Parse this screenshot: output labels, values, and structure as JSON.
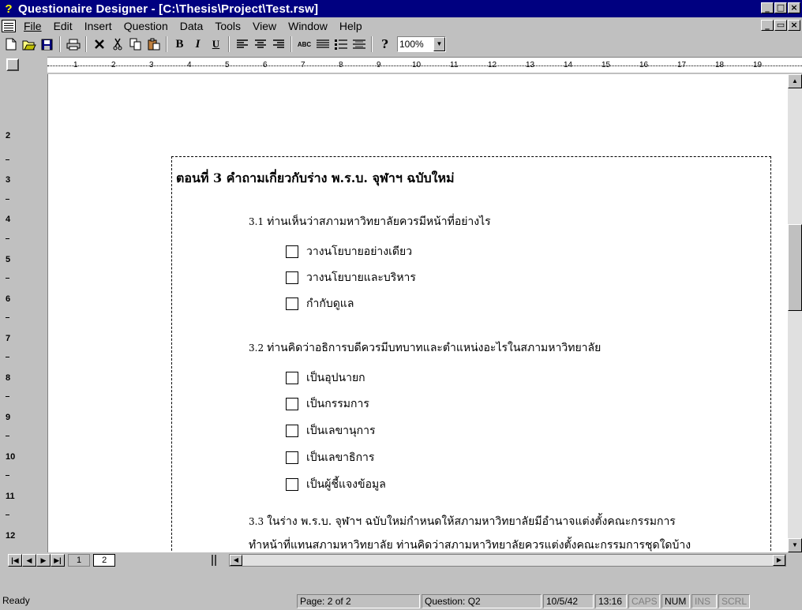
{
  "window": {
    "app_icon": "?",
    "title": "Questionaire Designer - [C:\\Thesis\\Project\\Test.rsw]",
    "buttons": [
      "_",
      "□",
      "×"
    ],
    "mdi_buttons": [
      "_",
      "▭",
      "×"
    ]
  },
  "menu": {
    "items": [
      "File",
      "Edit",
      "Insert",
      "Question",
      "Data",
      "Tools",
      "View",
      "Window",
      "Help"
    ]
  },
  "toolbar": {
    "bold": "B",
    "italic": "I",
    "underline": "U",
    "abc": "ABC",
    "help": "?",
    "zoom": "100%",
    "icons": [
      "new-icon",
      "open-icon",
      "save-icon",
      "print-icon",
      "delete-icon",
      "cut-icon",
      "copy-icon",
      "paste-icon",
      "bold-icon",
      "italic-icon",
      "underline-icon",
      "align-left-icon",
      "align-center-icon",
      "align-right-icon",
      "spell-icon",
      "list-icon",
      "bullet-list-icon",
      "line-spacing-icon",
      "help-icon"
    ]
  },
  "ruler": {
    "h_ticks": [
      "1",
      "2",
      "3",
      "4",
      "5",
      "6",
      "7",
      "8",
      "9",
      "10",
      "11",
      "12",
      "13",
      "14",
      "15",
      "16",
      "17",
      "18",
      "19"
    ],
    "v_ticks": [
      "2",
      "3",
      "4",
      "5",
      "6",
      "7",
      "8",
      "9",
      "10",
      "11",
      "12"
    ]
  },
  "document": {
    "section_title": "ตอนที่ 3 คำถามเกี่ยวกับร่าง พ.ร.บ. จุฬาฯ ฉบับใหม่",
    "questions": [
      {
        "number": "3.1",
        "text": "ท่านเห็นว่าสภามหาวิทยาลัยควรมีหน้าที่อย่างไร",
        "options": [
          "วางนโยบายอย่างเดียว",
          "วางนโยบายและบริหาร",
          "กำกับดูแล"
        ]
      },
      {
        "number": "3.2",
        "text": "ท่านคิดว่าอธิการบดีควรมีบทบาทและตำแหน่งอะไรในสภามหาวิทยาลัย",
        "options": [
          "เป็นอุปนายก",
          "เป็นกรรมการ",
          "เป็นเลขานุการ",
          "เป็นเลขาธิการ",
          "เป็นผู้ชี้แจงข้อมูล"
        ]
      },
      {
        "number": "3.3",
        "text": "ในร่าง พ.ร.บ. จุฬาฯ ฉบับใหม่กำหนดให้สภามหาวิทยาลัยมีอำนาจแต่งตั้งคณะกรรมการ",
        "text2": "ทำหน้าที่แทนสภามหาวิทยาลัย ท่านคิดว่าสภามหาวิทยาลัยควรแต่งตั้งคณะกรรมการชุดใดบ้าง"
      }
    ]
  },
  "nav": {
    "pages": [
      "1",
      "2"
    ],
    "active_page": "2"
  },
  "status": {
    "ready": "Ready",
    "page": "Page: 2 of 2",
    "question": "Question: Q2",
    "date": "10/5/42",
    "time": "13:16",
    "caps": "CAPS",
    "num": "NUM",
    "ins": "INS",
    "scrl": "SCRL"
  }
}
